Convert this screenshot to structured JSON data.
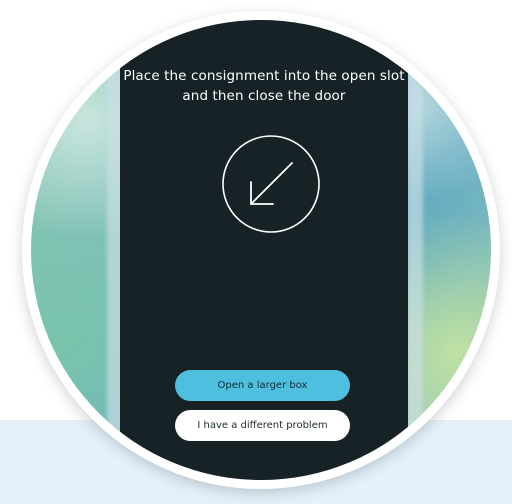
{
  "screen": {
    "instruction": "Place the consignment into the open slot and then close the door",
    "icon": "arrow-down-left-circle-icon"
  },
  "actions": {
    "open_larger_box_label": "Open a larger box",
    "different_problem_label": "I have a different problem"
  },
  "colors": {
    "screen_background": "#172227",
    "primary_button": "#4ebfde",
    "secondary_button": "#ffffff",
    "page_band": "#e4f1fb"
  }
}
